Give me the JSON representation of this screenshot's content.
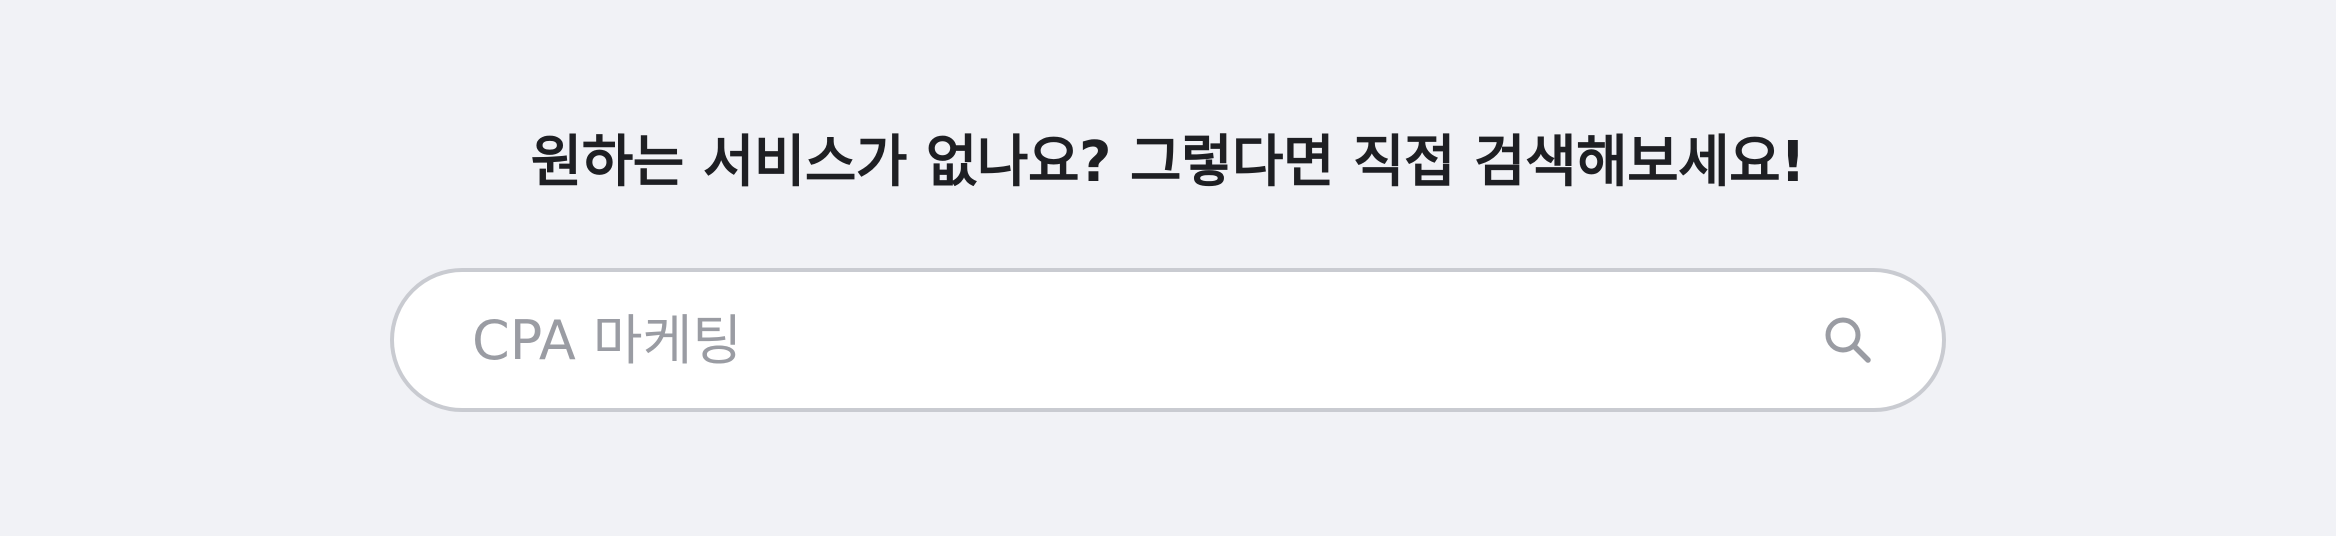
{
  "heading": "원하는 서비스가 없나요? 그렇다면 직접 검색해보세요!",
  "search": {
    "value": "",
    "placeholder": "CPA 마케팅",
    "button_icon": "search-icon"
  },
  "colors": {
    "background": "#f1f2f6",
    "heading_text": "#1e1f23",
    "input_border": "#c9cbd1",
    "placeholder": "#9a9ca3",
    "icon": "#9a9ca3"
  }
}
